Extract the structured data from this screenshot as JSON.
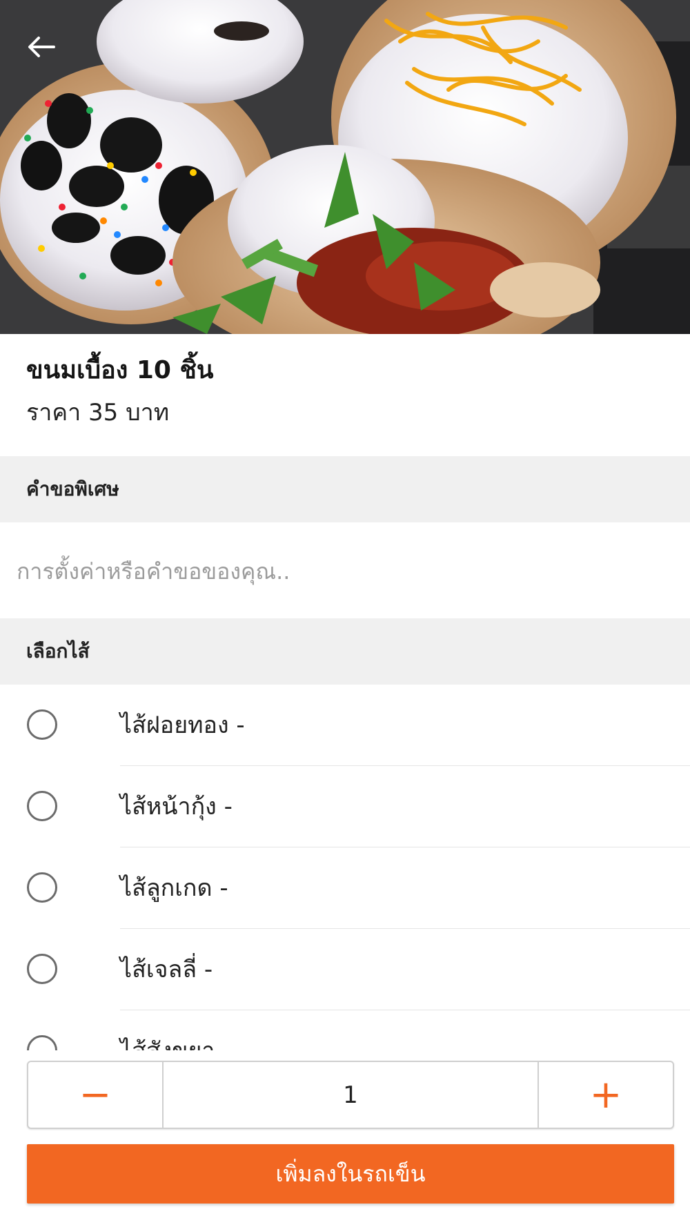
{
  "product": {
    "image_icon": "dessert-photo",
    "name": "ขนมเบื้อง 10 ชิ้น",
    "price": "ราคา 35 บาท"
  },
  "special_request": {
    "header": "คำขอพิเศษ",
    "placeholder": "การตั้งค่าหรือคำขอของคุณ..",
    "value": ""
  },
  "filling": {
    "header": "เลือกไส้",
    "options": [
      {
        "label": "ไส้ฝอยทอง  -"
      },
      {
        "label": "ไส้หน้ากุ้ง  -"
      },
      {
        "label": "ไส้ลูกเกด  -"
      },
      {
        "label": "ไส้เจลลี่  -"
      },
      {
        "label": "ไส้สังขยา  -"
      }
    ]
  },
  "quantity": {
    "minus_symbol": "−",
    "value": "1",
    "plus_symbol": "+"
  },
  "add_to_cart": {
    "label": "เพิ่มลงในรถเข็น"
  },
  "colors": {
    "accent": "#f26722",
    "section_bg": "#f0f0f0"
  }
}
